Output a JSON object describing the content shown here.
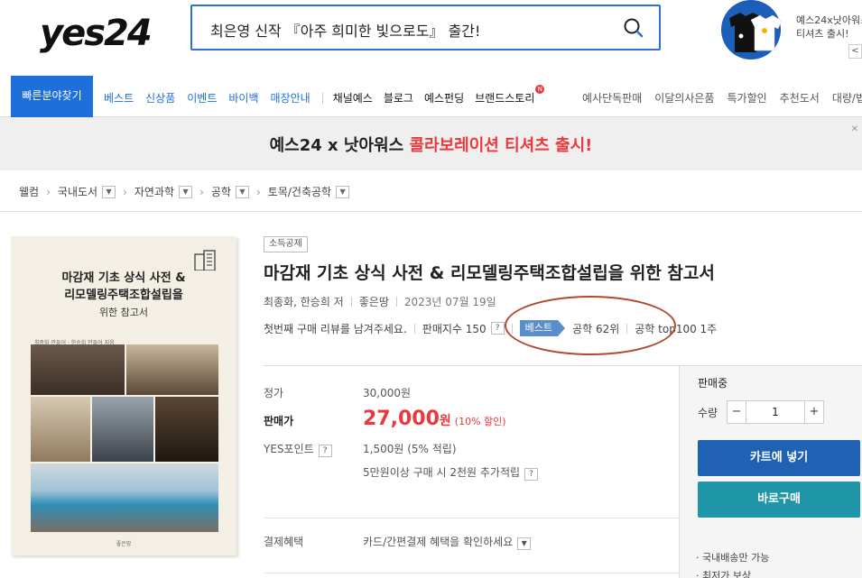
{
  "header": {
    "search_text": "최은영 신작 『아주 희미한 빛으로도』 출간!",
    "promo_line1": "예스24x낫아워스",
    "promo_line2": "티셔츠 출시!",
    "promo_arrow": "<"
  },
  "nav": {
    "quick": "빠른분야찾기",
    "blue_items": [
      "베스트",
      "신상품",
      "이벤트",
      "바이백",
      "매장안내"
    ],
    "dark_items": [
      "채널예스",
      "블로그",
      "예스펀딩",
      "브랜드스토리"
    ],
    "new_badge": "N",
    "right_items": [
      "예사단독판매",
      "이달의사은품",
      "특가할인",
      "추천도서",
      "대량/법"
    ]
  },
  "banner": {
    "prefix": "예스24 x 낫아워스 ",
    "highlight": "콜라보레이션 티셔츠 출시!"
  },
  "breadcrumb": {
    "home": "웰컴",
    "items": [
      "국내도서",
      "자연과학",
      "공학",
      "토목/건축공학"
    ]
  },
  "cover": {
    "title_line1": "마감재 기초 상식 사전 &",
    "title_line2": "리모델링주택조합설립을",
    "subtitle": "위한 참고서",
    "author_small": "최종화 만들어 · 한승희 만들어 지음",
    "publisher_small": "좋은땅"
  },
  "product": {
    "tag": "소득공제",
    "title": "마감재 기초 상식 사전 & 리모델링주택조합설립을 위한 참고서",
    "authors": "최종화, 한승희 저",
    "publisher": "좋은땅",
    "date": "2023년 07월 19일",
    "review_prompt": "첫번째 구매 리뷰를 남겨주세요.",
    "sales_index": "판매지수 150",
    "best_label": "베스트",
    "rank1": "공학 62위",
    "rank2": "공학 top100 1주"
  },
  "price": {
    "list_label": "정가",
    "list_value": "30,000원",
    "sale_label": "판매가",
    "sale_num": "27,000",
    "sale_won": "원",
    "sale_discount": "(10% 할인)",
    "point_label": "YES포인트",
    "point_value": "1,500원 (5% 적립)",
    "point_extra": "5만원이상 구매 시 2천원 추가적립",
    "benefit_label": "결제혜택",
    "benefit_value": "카드/간편결제 혜택을 확인하세요",
    "help": "?"
  },
  "panel": {
    "status": "판매중",
    "qty_label": "수량",
    "qty_value": "1",
    "minus": "−",
    "plus": "+",
    "cart": "카트에 넣기",
    "buy": "바로구매",
    "note1": "· 국내배송만 가능",
    "note2": "· 최저가 보상"
  },
  "colors": {
    "accent_blue": "#1e6fd9",
    "sale_red": "#e8393d",
    "cart_blue": "#1f62b4",
    "buy_teal": "#1f96a8",
    "annotation_circle": "#b04a2d"
  }
}
